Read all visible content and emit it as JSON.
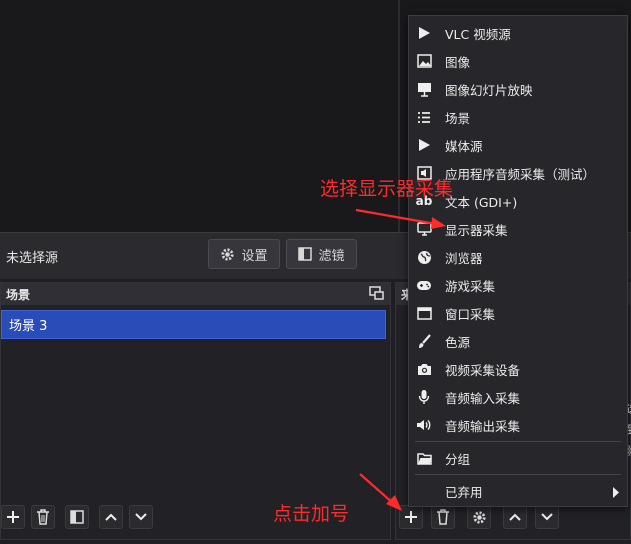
{
  "toolbar": {
    "no_source_label": "未选择源",
    "settings_label": "设置",
    "filters_label": "滤镜"
  },
  "scenes_panel": {
    "title": "场景",
    "items": [
      "场景 3"
    ]
  },
  "sources_panel": {
    "title_fragment": "来"
  },
  "context_menu": {
    "items": [
      {
        "label": "VLC 视频源",
        "icon": "play-icon"
      },
      {
        "label": "图像",
        "icon": "image-icon"
      },
      {
        "label": "图像幻灯片放映",
        "icon": "slideshow-icon"
      },
      {
        "label": "场景",
        "icon": "list-icon"
      },
      {
        "label": "媒体源",
        "icon": "play-icon"
      },
      {
        "label": "应用程序音频采集（测试）",
        "icon": "app-audio-icon"
      },
      {
        "label": "文本 (GDI+)",
        "icon": "text-icon"
      },
      {
        "label": "显示器采集",
        "icon": "monitor-icon"
      },
      {
        "label": "浏览器",
        "icon": "globe-icon"
      },
      {
        "label": "游戏采集",
        "icon": "gamepad-icon"
      },
      {
        "label": "窗口采集",
        "icon": "window-icon"
      },
      {
        "label": "色源",
        "icon": "brush-icon"
      },
      {
        "label": "视频采集设备",
        "icon": "camera-icon"
      },
      {
        "label": "音频输入采集",
        "icon": "microphone-icon"
      },
      {
        "label": "音频输出采集",
        "icon": "speaker-icon"
      }
    ],
    "group_label": "分组",
    "deprecated_label": "已弃用"
  },
  "annotations": {
    "select_display": "选择显示器采集",
    "click_plus": "点击加号"
  },
  "right_edge_fragments": [
    "选",
    "到",
    "》"
  ],
  "colors": {
    "selection": "#2a4cb8",
    "annotation": "#ff2a2a",
    "menu_bg": "#26262b"
  }
}
